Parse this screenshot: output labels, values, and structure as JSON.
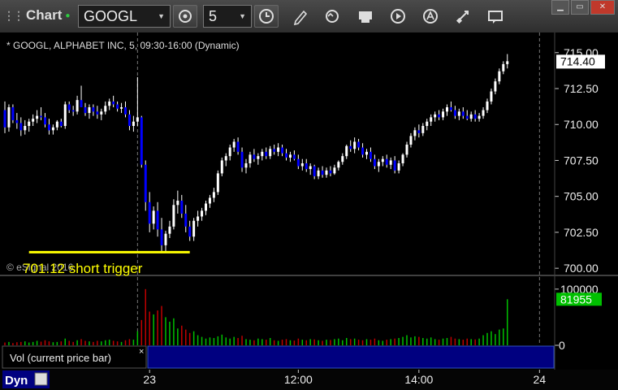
{
  "toolbar": {
    "app_title": "Chart",
    "symbol": "GOOGL",
    "interval": "5",
    "icons": [
      "link-settings-icon",
      "clock-icon",
      "pencil-icon",
      "refresh-icon",
      "data-icon",
      "play-icon",
      "alert-icon",
      "tools-icon",
      "comment-icon"
    ]
  },
  "window": {
    "min": "▁",
    "max": "▭",
    "close": "✕"
  },
  "chart": {
    "title": "* GOOGL, ALPHABET INC, 5, 09:30-16:00 (Dynamic)",
    "annotation": "701.12 short trigger",
    "watermark": "© eSignal 2016",
    "last_price_label": "714.40"
  },
  "volume": {
    "panel_label": "Vol (current price bar)",
    "last_value_label": "81955",
    "close_glyph": "×"
  },
  "footer": {
    "dyn_label": "Dyn"
  },
  "colors": {
    "up": "#ffffff",
    "down": "#0000ff",
    "vol_up": "#00c000",
    "vol_down": "#c00000",
    "trigger": "#ffff00",
    "volume_tag": "#00c000",
    "panel_bar": "#000080"
  },
  "chart_data": {
    "type": "candlestick",
    "title": "* GOOGL, ALPHABET INC, 5, 09:30-16:00 (Dynamic)",
    "price_axis": {
      "ylim": [
        699.5,
        716.4
      ],
      "ticks": [
        700.0,
        702.5,
        705.0,
        707.5,
        710.0,
        712.5,
        715.0
      ]
    },
    "volume_axis": {
      "ylim": [
        0,
        120000
      ],
      "ticks": [
        0,
        100000
      ]
    },
    "x_tick_labels": [
      "23",
      "12:00",
      "14:00",
      "24"
    ],
    "x_tick_bar_index": [
      36,
      73,
      103,
      133
    ],
    "day_break_bar_index": [
      33,
      133
    ],
    "trigger_level": 701.12,
    "last_price": 714.4,
    "last_volume": 81955,
    "candles": [
      [
        711.0,
        711.6,
        709.4,
        709.8
      ],
      [
        709.8,
        711.4,
        709.5,
        711.2
      ],
      [
        711.2,
        711.4,
        710.1,
        710.3
      ],
      [
        710.3,
        710.8,
        709.7,
        710.1
      ],
      [
        710.1,
        710.5,
        709.2,
        709.6
      ],
      [
        709.6,
        710.3,
        709.3,
        709.9
      ],
      [
        709.9,
        710.4,
        709.5,
        710.2
      ],
      [
        710.2,
        710.7,
        709.9,
        710.4
      ],
      [
        710.4,
        711.0,
        710.1,
        710.6
      ],
      [
        710.6,
        711.2,
        710.3,
        710.5
      ],
      [
        710.5,
        710.8,
        709.8,
        710.0
      ],
      [
        710.0,
        710.4,
        709.3,
        709.6
      ],
      [
        709.6,
        710.0,
        709.3,
        709.8
      ],
      [
        709.8,
        710.3,
        709.6,
        710.2
      ],
      [
        710.2,
        710.4,
        709.8,
        709.9
      ],
      [
        709.9,
        711.6,
        709.7,
        711.4
      ],
      [
        711.4,
        711.6,
        710.8,
        711.0
      ],
      [
        711.0,
        711.3,
        710.6,
        710.9
      ],
      [
        710.9,
        712.0,
        710.7,
        711.7
      ],
      [
        711.7,
        712.7,
        711.3,
        711.2
      ],
      [
        711.2,
        711.5,
        710.6,
        710.8
      ],
      [
        710.8,
        711.4,
        710.4,
        711.2
      ],
      [
        711.2,
        711.4,
        710.6,
        710.9
      ],
      [
        710.9,
        711.3,
        710.4,
        710.7
      ],
      [
        710.7,
        711.1,
        710.3,
        710.9
      ],
      [
        710.9,
        711.6,
        710.7,
        711.3
      ],
      [
        711.3,
        711.8,
        711.0,
        711.6
      ],
      [
        711.6,
        712.0,
        711.2,
        711.4
      ],
      [
        711.4,
        711.6,
        710.9,
        711.1
      ],
      [
        711.1,
        711.5,
        710.8,
        711.2
      ],
      [
        711.2,
        711.6,
        710.5,
        710.7
      ],
      [
        710.7,
        711.0,
        709.6,
        709.9
      ],
      [
        709.9,
        710.6,
        709.5,
        710.2
      ],
      [
        710.2,
        713.3,
        709.9,
        710.5
      ],
      [
        710.5,
        710.6,
        707.0,
        707.2
      ],
      [
        707.2,
        707.5,
        704.0,
        704.6
      ],
      [
        704.6,
        705.3,
        702.5,
        703.1
      ],
      [
        703.1,
        704.3,
        702.7,
        704.0
      ],
      [
        704.0,
        704.6,
        702.2,
        702.7
      ],
      [
        702.7,
        703.5,
        701.2,
        701.6
      ],
      [
        701.6,
        702.6,
        701.1,
        702.4
      ],
      [
        702.4,
        703.3,
        702.1,
        702.9
      ],
      [
        702.9,
        704.8,
        702.7,
        704.4
      ],
      [
        704.4,
        705.4,
        703.8,
        704.7
      ],
      [
        704.7,
        705.1,
        703.5,
        703.8
      ],
      [
        703.8,
        704.4,
        702.5,
        702.9
      ],
      [
        702.9,
        703.3,
        701.9,
        702.2
      ],
      [
        702.2,
        703.5,
        701.9,
        703.3
      ],
      [
        703.3,
        704.0,
        702.9,
        703.6
      ],
      [
        703.6,
        704.2,
        703.3,
        704.0
      ],
      [
        704.0,
        704.7,
        703.7,
        704.5
      ],
      [
        704.5,
        705.1,
        704.2,
        704.9
      ],
      [
        704.9,
        705.6,
        704.6,
        705.3
      ],
      [
        705.3,
        706.8,
        705.1,
        706.6
      ],
      [
        706.6,
        707.7,
        706.4,
        707.5
      ],
      [
        707.5,
        708.0,
        707.1,
        707.8
      ],
      [
        707.8,
        708.6,
        707.5,
        708.4
      ],
      [
        708.4,
        709.0,
        708.1,
        708.8
      ],
      [
        708.8,
        709.1,
        707.9,
        708.1
      ],
      [
        708.1,
        708.4,
        706.7,
        707.0
      ],
      [
        707.0,
        707.6,
        706.6,
        707.3
      ],
      [
        707.3,
        708.1,
        707.0,
        707.9
      ],
      [
        707.9,
        708.3,
        707.4,
        707.6
      ],
      [
        707.6,
        708.0,
        707.2,
        707.8
      ],
      [
        707.8,
        708.3,
        707.5,
        708.1
      ],
      [
        708.1,
        708.4,
        707.6,
        707.8
      ],
      [
        707.8,
        708.5,
        707.6,
        708.3
      ],
      [
        708.3,
        708.6,
        707.9,
        708.1
      ],
      [
        708.1,
        708.7,
        707.8,
        708.4
      ],
      [
        708.4,
        708.6,
        707.8,
        708.0
      ],
      [
        708.0,
        708.3,
        707.5,
        707.7
      ],
      [
        707.7,
        708.1,
        707.4,
        707.9
      ],
      [
        707.9,
        708.2,
        707.5,
        707.6
      ],
      [
        707.6,
        707.9,
        706.9,
        707.1
      ],
      [
        707.1,
        707.6,
        706.8,
        707.3
      ],
      [
        707.3,
        707.6,
        706.7,
        706.9
      ],
      [
        706.9,
        707.3,
        706.5,
        707.1
      ],
      [
        707.1,
        707.2,
        706.2,
        706.4
      ],
      [
        706.4,
        707.0,
        706.2,
        706.8
      ],
      [
        706.8,
        707.1,
        706.3,
        706.5
      ],
      [
        706.5,
        707.0,
        706.3,
        706.8
      ],
      [
        706.8,
        707.1,
        706.4,
        706.6
      ],
      [
        706.6,
        707.2,
        706.5,
        707.0
      ],
      [
        707.0,
        707.5,
        706.8,
        707.4
      ],
      [
        707.4,
        708.0,
        707.2,
        707.8
      ],
      [
        707.8,
        708.6,
        707.6,
        708.5
      ],
      [
        708.5,
        708.9,
        708.1,
        708.3
      ],
      [
        708.3,
        709.1,
        708.0,
        708.8
      ],
      [
        708.8,
        709.0,
        708.2,
        708.4
      ],
      [
        708.4,
        708.7,
        707.7,
        707.9
      ],
      [
        707.9,
        708.3,
        707.6,
        708.1
      ],
      [
        708.1,
        708.4,
        707.4,
        707.6
      ],
      [
        707.6,
        707.9,
        706.9,
        707.1
      ],
      [
        707.1,
        707.6,
        706.7,
        707.4
      ],
      [
        707.4,
        707.8,
        707.1,
        707.6
      ],
      [
        707.6,
        707.9,
        707.0,
        707.2
      ],
      [
        707.2,
        707.7,
        706.9,
        707.5
      ],
      [
        707.5,
        707.8,
        706.6,
        706.8
      ],
      [
        706.8,
        707.5,
        706.6,
        707.3
      ],
      [
        707.3,
        708.0,
        707.1,
        707.9
      ],
      [
        707.9,
        708.8,
        707.7,
        708.6
      ],
      [
        708.6,
        709.4,
        708.4,
        709.2
      ],
      [
        709.2,
        709.8,
        708.9,
        709.6
      ],
      [
        709.6,
        710.0,
        709.1,
        709.4
      ],
      [
        709.4,
        710.1,
        709.2,
        709.9
      ],
      [
        709.9,
        710.4,
        709.6,
        710.2
      ],
      [
        710.2,
        710.7,
        709.9,
        710.5
      ],
      [
        710.5,
        710.9,
        710.2,
        710.7
      ],
      [
        710.7,
        711.0,
        710.3,
        710.5
      ],
      [
        710.5,
        711.1,
        710.3,
        710.9
      ],
      [
        710.9,
        711.4,
        710.6,
        711.2
      ],
      [
        711.2,
        711.6,
        710.9,
        711.0
      ],
      [
        711.0,
        711.3,
        710.4,
        710.6
      ],
      [
        710.6,
        711.1,
        710.3,
        710.9
      ],
      [
        710.9,
        711.2,
        710.4,
        710.6
      ],
      [
        710.6,
        711.0,
        710.3,
        710.4
      ],
      [
        710.4,
        710.9,
        710.2,
        710.7
      ],
      [
        710.7,
        711.0,
        710.2,
        710.4
      ],
      [
        710.4,
        710.8,
        710.2,
        710.6
      ],
      [
        710.6,
        711.2,
        710.4,
        711.0
      ],
      [
        711.0,
        711.8,
        710.8,
        711.6
      ],
      [
        711.6,
        712.5,
        711.4,
        712.3
      ],
      [
        712.3,
        713.2,
        712.1,
        713.0
      ],
      [
        713.0,
        713.9,
        712.8,
        713.7
      ],
      [
        713.7,
        714.4,
        713.5,
        714.2
      ],
      [
        714.2,
        714.9,
        713.9,
        714.4
      ]
    ],
    "volumes": [
      5000,
      6000,
      4000,
      5500,
      6000,
      7000,
      5000,
      6000,
      8000,
      6500,
      9000,
      7000,
      5500,
      6000,
      7000,
      12000,
      8000,
      6000,
      9000,
      11000,
      8000,
      7000,
      6000,
      8000,
      7000,
      9000,
      10000,
      8000,
      7000,
      6000,
      9000,
      11000,
      10000,
      25000,
      45000,
      100000,
      60000,
      55000,
      62000,
      70000,
      50000,
      42000,
      48000,
      30000,
      35000,
      28000,
      22000,
      25000,
      18000,
      15000,
      12000,
      14000,
      13000,
      16000,
      19000,
      14000,
      12000,
      15000,
      13000,
      17000,
      11000,
      10000,
      9000,
      12000,
      11000,
      10000,
      13000,
      9000,
      8000,
      10000,
      11000,
      9000,
      8500,
      12000,
      10000,
      9000,
      11000,
      10500,
      9000,
      8000,
      10000,
      9500,
      11000,
      12000,
      9000,
      13000,
      11000,
      12000,
      10000,
      9000,
      11000,
      10000,
      12000,
      9000,
      8000,
      10000,
      11000,
      12000,
      13000,
      15000,
      18000,
      14000,
      16000,
      15000,
      13000,
      12000,
      14000,
      11000,
      10000,
      12000,
      13000,
      15000,
      12000,
      11000,
      10000,
      12000,
      11000,
      10500,
      12000,
      18000,
      22000,
      25000,
      20000,
      28000,
      30000,
      81955
    ]
  }
}
